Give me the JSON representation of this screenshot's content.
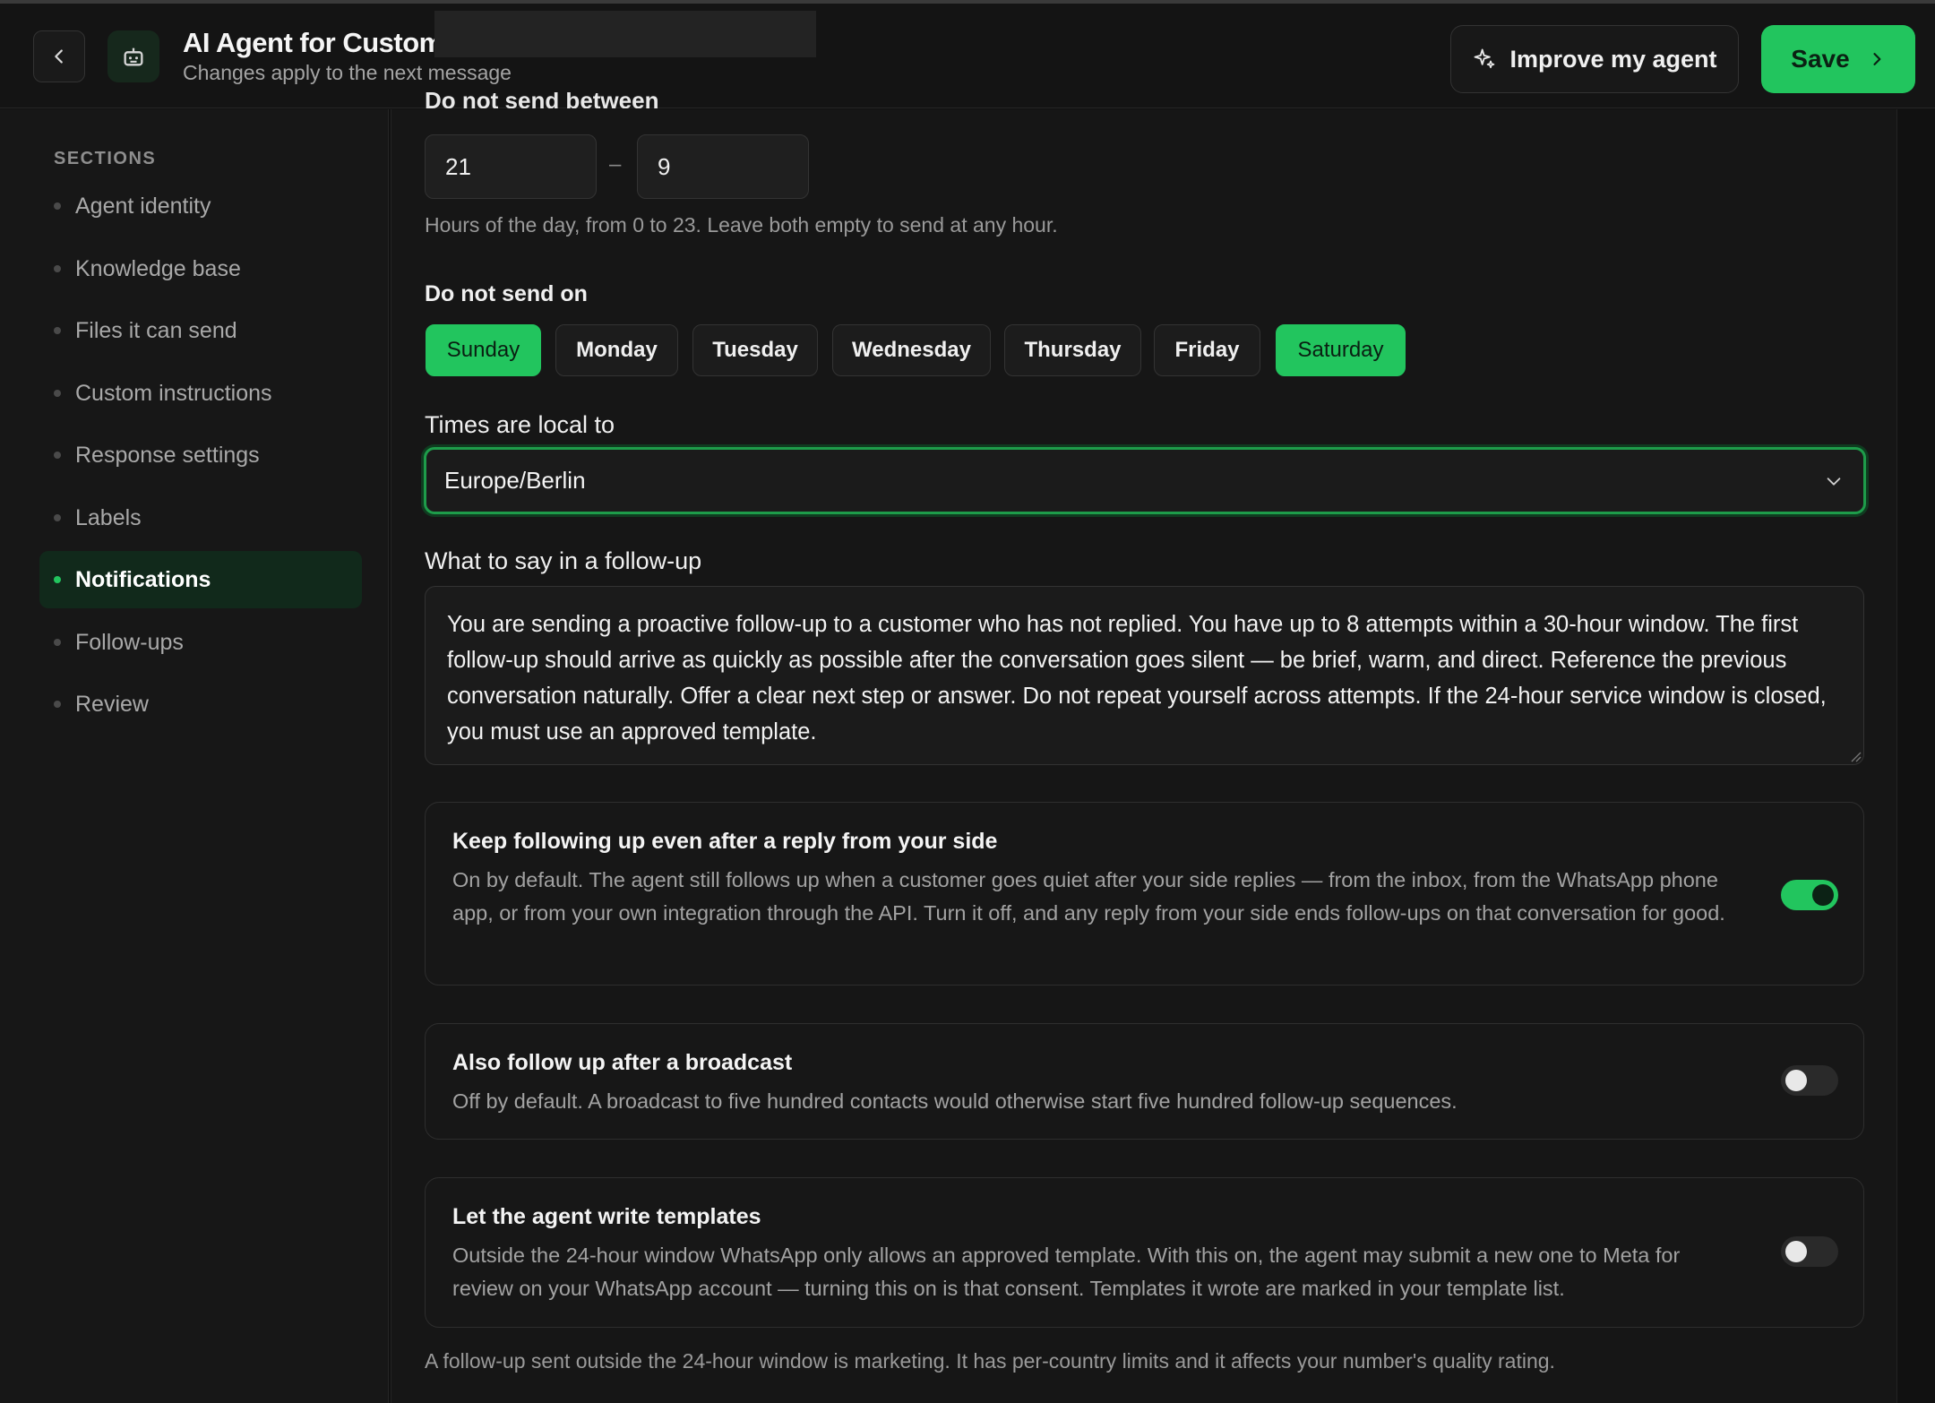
{
  "header": {
    "title": "AI Agent for Custome",
    "subtitle": "Changes apply to the next message",
    "improve_label": "Improve my agent",
    "save_label": "Save"
  },
  "sidebar": {
    "heading": "SECTIONS",
    "items": [
      {
        "label": "Agent identity"
      },
      {
        "label": "Knowledge base"
      },
      {
        "label": "Files it can send"
      },
      {
        "label": "Custom instructions"
      },
      {
        "label": "Response settings"
      },
      {
        "label": "Labels"
      },
      {
        "label": "Notifications",
        "active": true
      },
      {
        "label": "Follow-ups"
      },
      {
        "label": "Review"
      }
    ]
  },
  "quiet_hours": {
    "label": "Do not send between",
    "from": "21",
    "to": "9",
    "separator": "–",
    "helper": "Hours of the day, from 0 to 23. Leave both empty to send at any hour."
  },
  "days": {
    "label": "Do not send on",
    "items": [
      {
        "label": "Sunday",
        "selected": true
      },
      {
        "label": "Monday",
        "selected": false
      },
      {
        "label": "Tuesday",
        "selected": false
      },
      {
        "label": "Wednesday",
        "selected": false
      },
      {
        "label": "Thursday",
        "selected": false
      },
      {
        "label": "Friday",
        "selected": false
      },
      {
        "label": "Saturday",
        "selected": true
      }
    ]
  },
  "timezone": {
    "label": "Times are local to",
    "value": "Europe/Berlin"
  },
  "followup_message": {
    "label": "What to say in a follow-up",
    "text": "You are sending a proactive follow-up to a customer who has not replied. You have up to 8 attempts within a 30-hour window. The first follow-up should arrive as quickly as possible after the conversation goes silent — be brief, warm, and direct. Reference the previous conversation naturally. Offer a clear next step or answer. Do not repeat yourself across attempts. If the 24-hour service window is closed, you must use an approved template."
  },
  "options": [
    {
      "title": "Keep following up even after a reply from your side",
      "description": "On by default. The agent still follows up when a customer goes quiet after your side replies — from the inbox, from the WhatsApp phone app, or from your own integration through the API. Turn it off, and any reply from your side ends follow-ups on that conversation for good.",
      "enabled": true
    },
    {
      "title": "Also follow up after a broadcast",
      "description": "Off by default. A broadcast to five hundred contacts would otherwise start five hundred follow-up sequences.",
      "enabled": false
    },
    {
      "title": "Let the agent write templates",
      "description": "Outside the 24-hour window WhatsApp only allows an approved template. With this on, the agent may submit a new one to Meta for review on your WhatsApp account — turning this on is that consent. Templates it wrote are marked in your template list.",
      "enabled": false
    }
  ],
  "footnote": "A follow-up sent outside the 24-hour window is marketing. It has per-country limits and it affects your number's quality rating.",
  "colors": {
    "accent": "#22c55e",
    "background": "#111111",
    "panel": "#161616"
  },
  "icons": {
    "back": "chevron-left-icon",
    "agent": "robot-icon",
    "improve": "sparkles-icon",
    "save": "chevron-right-icon",
    "select": "chevron-down-icon"
  }
}
